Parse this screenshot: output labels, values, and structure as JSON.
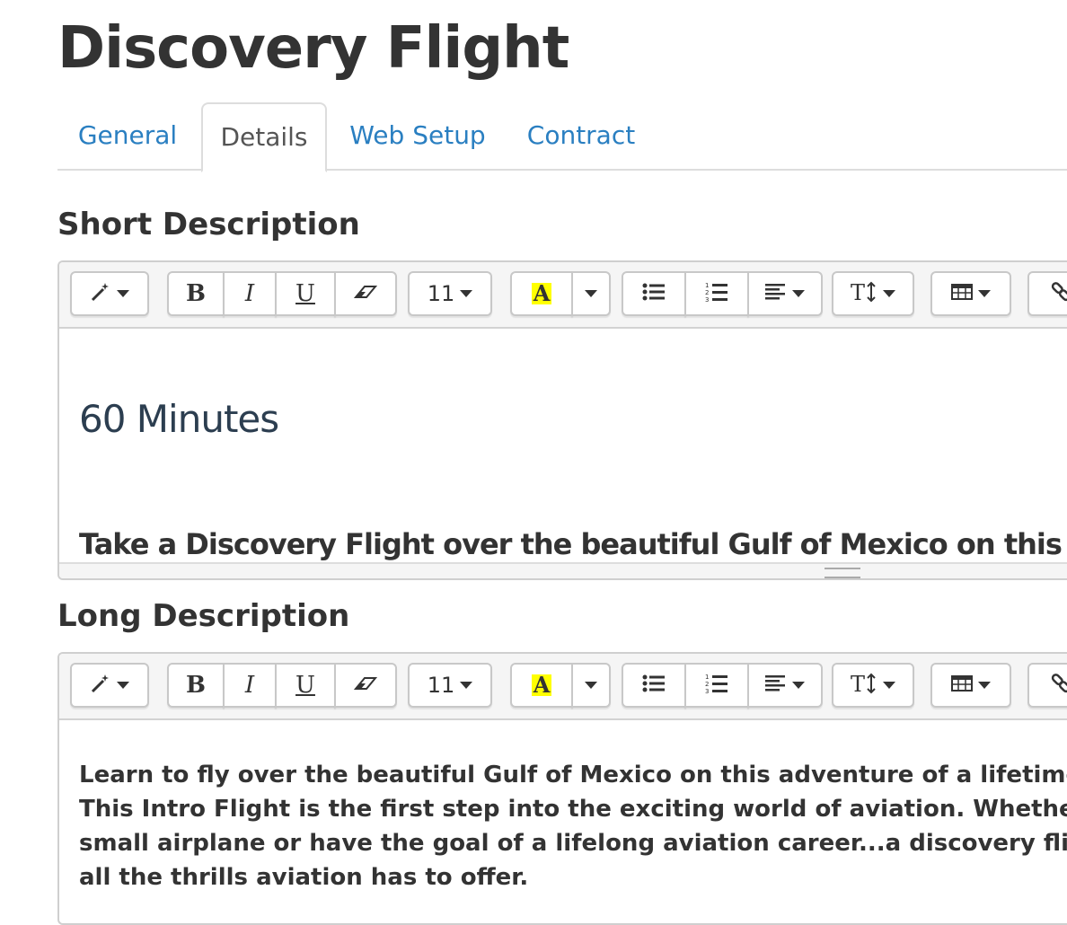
{
  "page": {
    "title": "Discovery Flight"
  },
  "tabs": [
    {
      "label": "General",
      "active": false
    },
    {
      "label": "Details",
      "active": true
    },
    {
      "label": "Web Setup",
      "active": false
    },
    {
      "label": "Contract",
      "active": false
    }
  ],
  "short_description": {
    "heading": "Short Description",
    "font_size": "11",
    "heading_text": "60 Minutes",
    "bold_line": "Take a Discovery Flight over the beautiful Gulf of Mexico on this adventure of a lifetime!"
  },
  "long_description": {
    "heading": "Long Description",
    "font_size": "11",
    "lines": [
      "Learn to fly over the beautiful Gulf of Mexico on this adventure of a lifetime!",
      "This Intro Flight is the first step into the exciting world of aviation. Whether you",
      "small airplane or have the goal of a lifelong aviation career...a discovery flight a",
      "all the thrills aviation has to offer."
    ]
  },
  "icons": {
    "style": "magic-wand-icon",
    "bold": "bold-icon",
    "italic": "italic-icon",
    "underline": "underline-icon",
    "clear": "eraser-icon",
    "highlight": "highlight-color-icon",
    "ul": "unordered-list-icon",
    "ol": "ordered-list-icon",
    "align": "align-left-icon",
    "height": "line-height-icon",
    "table": "table-icon",
    "link": "link-icon"
  },
  "colors": {
    "link": "#2a7fc1",
    "text": "#333333",
    "highlight": "#ffff00",
    "heading_blue": "#2c3e50"
  }
}
